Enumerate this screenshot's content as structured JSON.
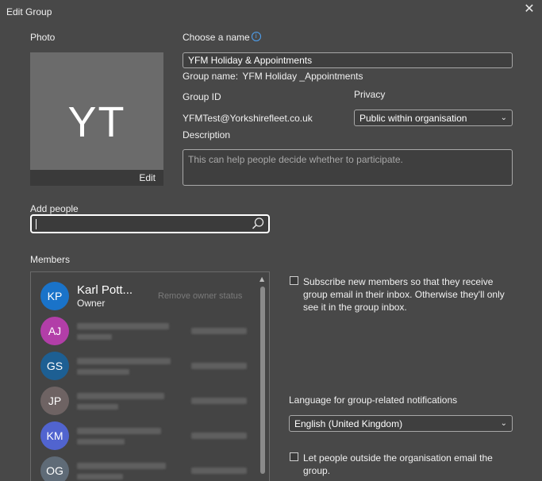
{
  "window": {
    "title": "Edit Group",
    "close_glyph": "✕"
  },
  "photo": {
    "label": "Photo",
    "initials": "YT",
    "edit_label": "Edit"
  },
  "name": {
    "label": "Choose a name",
    "value": "YFM Holiday & Appointments",
    "info_glyph": "i"
  },
  "group_name": {
    "label": "Group name:",
    "value": "YFM Holiday _Appointments"
  },
  "group_id": {
    "label": "Group ID",
    "value": "YFMTest@Yorkshirefleet.co.uk"
  },
  "privacy": {
    "label": "Privacy",
    "selected": "Public within organisation"
  },
  "description": {
    "label": "Description",
    "placeholder": "This can help people decide whether to participate."
  },
  "add_people": {
    "label": "Add people"
  },
  "members": {
    "label": "Members",
    "list": [
      {
        "initials": "KP",
        "name": "Karl Pott...",
        "role": "Owner",
        "action": "Remove owner status",
        "color": "#1a73c9"
      },
      {
        "initials": "AJ",
        "color": "#b23ea8"
      },
      {
        "initials": "GS",
        "color": "#1d5f93"
      },
      {
        "initials": "JP",
        "color": "#6e6363"
      },
      {
        "initials": "KM",
        "color": "#5164cf"
      },
      {
        "initials": "OG",
        "color": "#5f6b77"
      }
    ]
  },
  "subscribe": {
    "text": "Subscribe new members so that they receive group email in their inbox. Otherwise they'll only see it in the group inbox."
  },
  "language": {
    "label": "Language for group-related notifications",
    "selected": "English (United Kingdom)"
  },
  "outside": {
    "text": "Let people outside the organisation email the group."
  },
  "icons": {
    "close": "close-icon",
    "info": "info-icon",
    "search": "search-icon",
    "chevron": "chevron-down-icon"
  }
}
